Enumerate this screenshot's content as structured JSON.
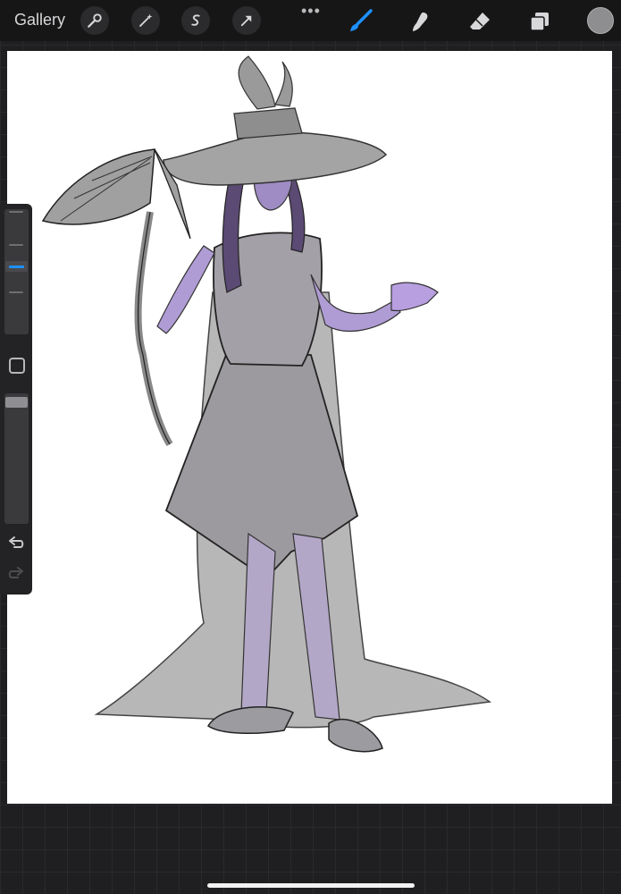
{
  "app": {
    "gallery_label": "Gallery",
    "more_menu": "•••"
  },
  "toolbar_left": {
    "icons": [
      "wrench-icon",
      "magic-wand-icon",
      "selection-icon",
      "transform-arrow-icon"
    ]
  },
  "toolbar_right": {
    "icons": [
      "brush-icon",
      "smudge-icon",
      "eraser-icon",
      "layers-icon"
    ],
    "active_tool": "brush",
    "accent": "#1e90ff",
    "current_color": "#8e8e90"
  },
  "sidebar": {
    "brush_size_level": 0.45,
    "opacity_level": 0.95,
    "icons": [
      "modify-square-icon",
      "undo-icon",
      "redo-icon"
    ]
  },
  "canvas": {
    "background": "#ffffff"
  }
}
